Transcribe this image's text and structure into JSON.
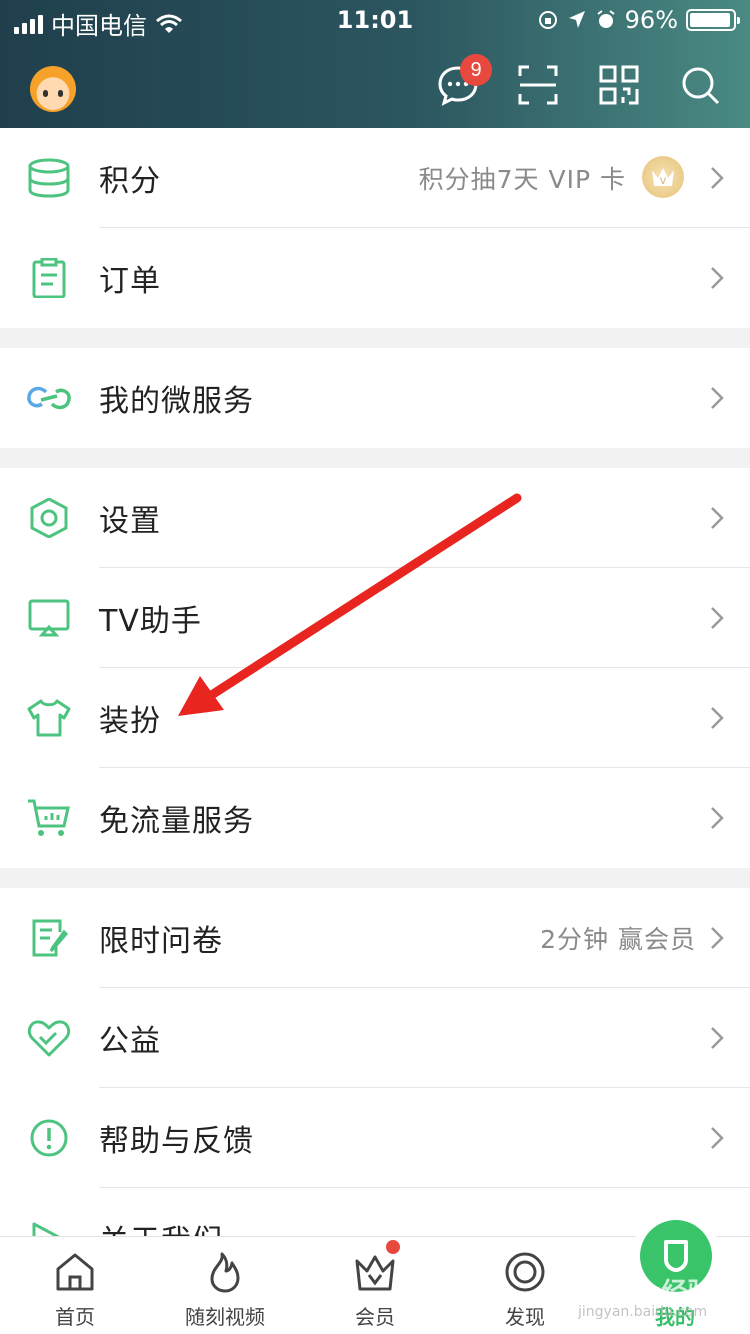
{
  "status_bar": {
    "carrier": "中国电信",
    "time": "11:01",
    "battery": "96%",
    "battery_level": 0.96
  },
  "header": {
    "message_badge": "9",
    "icons": [
      "message-icon",
      "scan-icon",
      "qrcode-icon",
      "search-icon"
    ]
  },
  "groups": [
    {
      "items": [
        {
          "label": "积分",
          "extra": "积分抽7天 VIP 卡",
          "icon": "coins-icon",
          "vip_badge": "V"
        },
        {
          "label": "订单",
          "icon": "clipboard-icon"
        }
      ]
    },
    {
      "items": [
        {
          "label": "我的微服务",
          "icon": "link-icon"
        }
      ]
    },
    {
      "items": [
        {
          "label": "设置",
          "icon": "settings-icon"
        },
        {
          "label": "TV助手",
          "icon": "tv-icon"
        },
        {
          "label": "装扮",
          "icon": "shirt-icon"
        },
        {
          "label": "免流量服务",
          "icon": "cart-icon"
        }
      ]
    },
    {
      "items": [
        {
          "label": "限时问卷",
          "extra": "2分钟 赢会员",
          "icon": "survey-icon"
        },
        {
          "label": "公益",
          "icon": "heart-icon"
        },
        {
          "label": "帮助与反馈",
          "icon": "help-icon"
        },
        {
          "label": "关于我们",
          "icon": "about-icon"
        }
      ]
    }
  ],
  "tabbar": [
    {
      "label": "首页",
      "icon": "home-icon"
    },
    {
      "label": "随刻视频",
      "icon": "flame-icon"
    },
    {
      "label": "会员",
      "icon": "crown-icon"
    },
    {
      "label": "发现",
      "icon": "discover-icon"
    },
    {
      "label": "我的",
      "icon": "profile-icon",
      "active": true
    }
  ],
  "colors": {
    "accent": "#35c067",
    "icon_green": "#4cc47f",
    "badge_red": "#e8493e",
    "arrow_red": "#e8251f"
  },
  "watermark": "Baidu经验",
  "watermark_url": "jingyan.baidu.com"
}
